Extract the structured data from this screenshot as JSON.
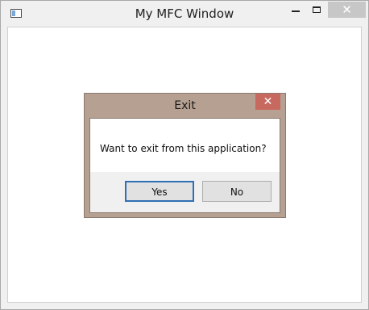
{
  "window": {
    "title": "My MFC Window",
    "close_glyph": "✕"
  },
  "dialog": {
    "title": "Exit",
    "close_glyph": "✕",
    "message": "Want to exit from this application?",
    "buttons": {
      "yes": "Yes",
      "no": "No"
    },
    "default_button": "yes",
    "icons": {
      "close": "close-icon"
    }
  },
  "colors": {
    "dialog_frame": "#b5a091",
    "dialog_close": "#c7695f",
    "focus_border": "#2f6fb5"
  }
}
